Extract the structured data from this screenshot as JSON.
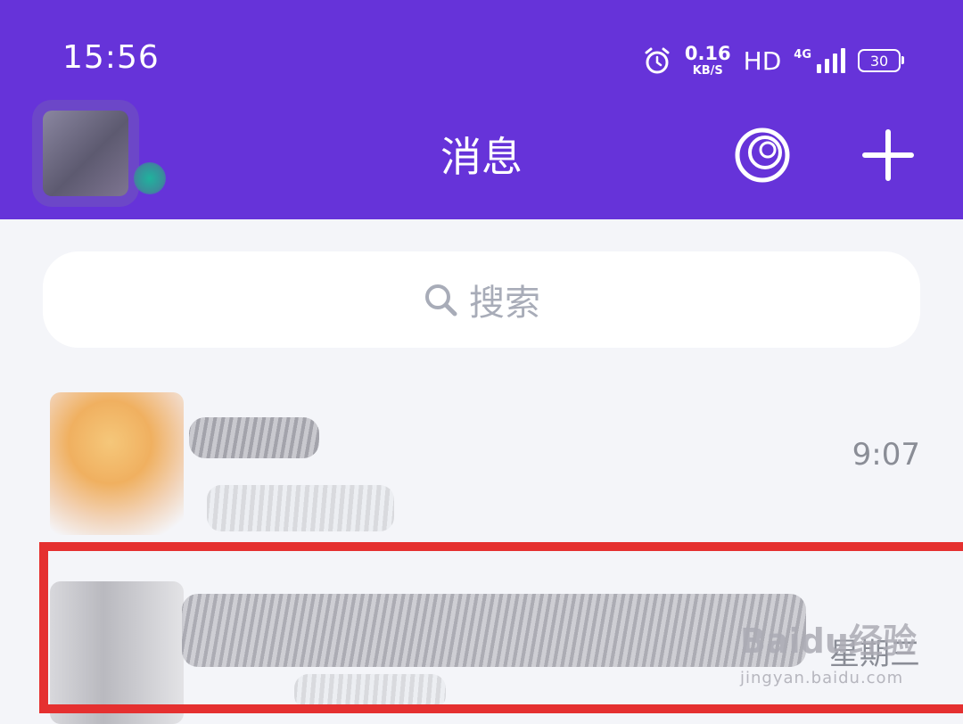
{
  "status_bar": {
    "time": "15:56",
    "speed_value": "0.16",
    "speed_unit": "KB/S",
    "hd": "HD",
    "network": "4G",
    "battery": "30",
    "icons": [
      "alarm-icon",
      "signal-icon",
      "battery-icon"
    ]
  },
  "header": {
    "title": "消息",
    "icons": [
      "profile-avatar",
      "circle-icon",
      "plus-icon"
    ],
    "background_color": "#6633d9"
  },
  "search": {
    "placeholder": "搜索",
    "icon": "search-icon"
  },
  "conversations": [
    {
      "time": "9:07"
    },
    {
      "time": "星期三"
    }
  ],
  "watermark": {
    "logo": "Baidu经验",
    "url": "jingyan.baidu.com"
  },
  "colors": {
    "accent": "#6633d9",
    "background": "#f4f5f9",
    "highlight": "#e53030"
  }
}
